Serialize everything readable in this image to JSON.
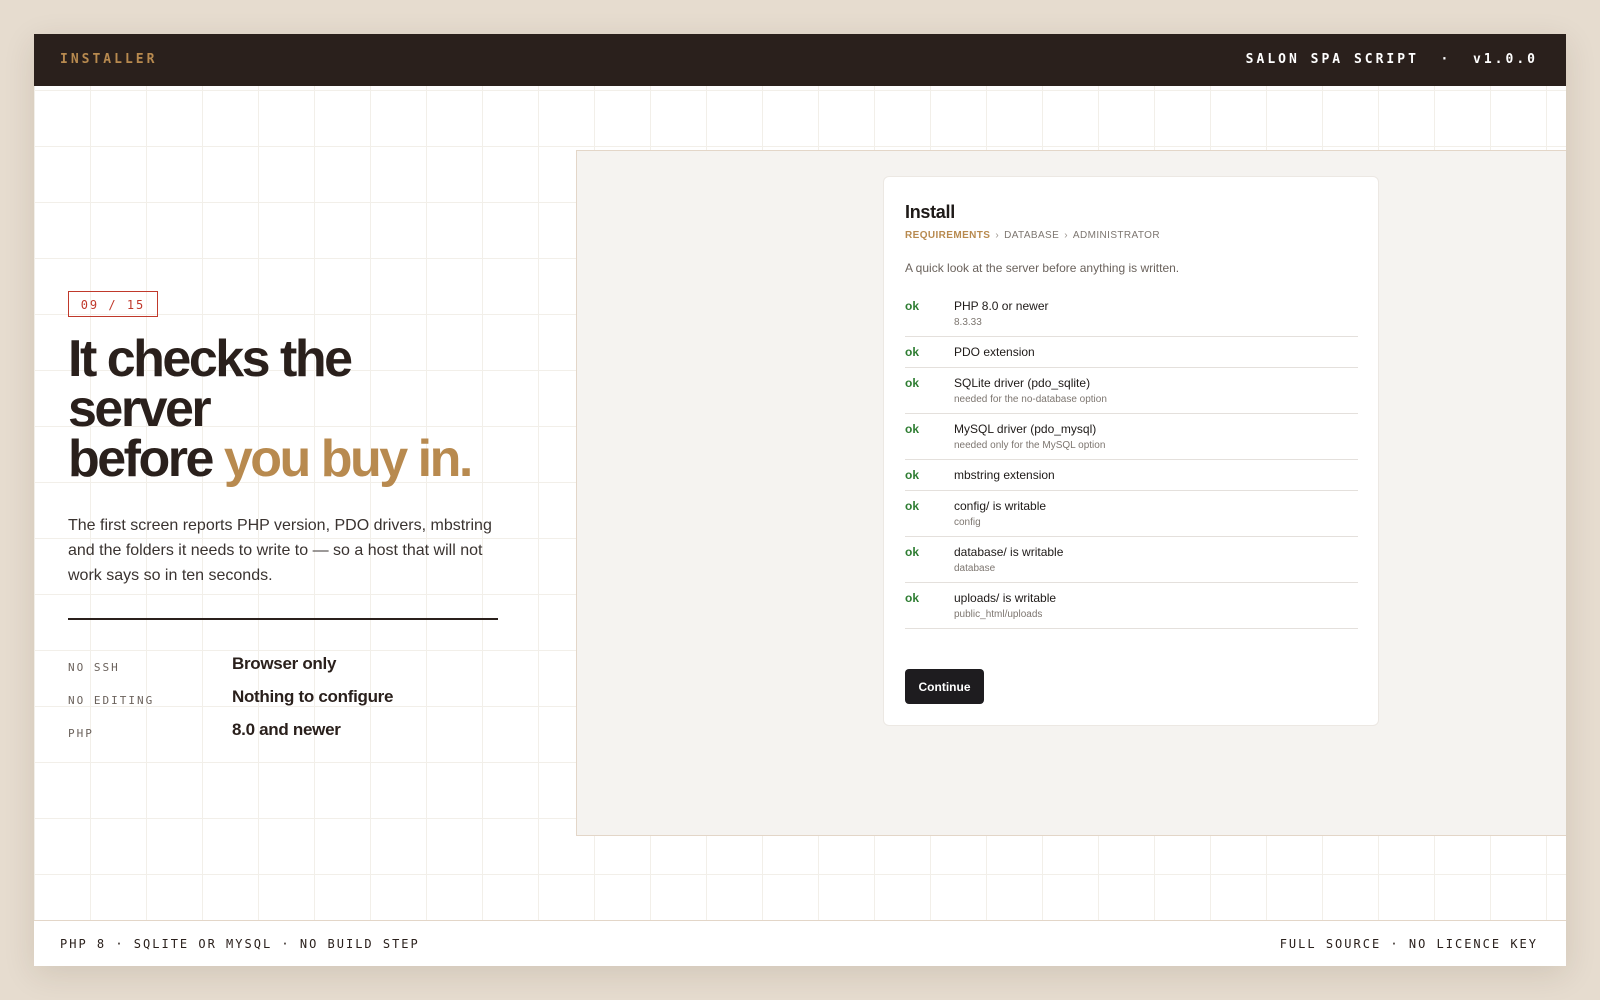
{
  "topbar": {
    "left_label": "INSTALLER",
    "right_label": "SALON SPA SCRIPT  ·  v1.0.0"
  },
  "slide": {
    "counter": "09 / 15",
    "headline_line1": "It checks the",
    "headline_line2": "server",
    "headline_line3_plain": "before ",
    "headline_line3_accent": "you buy in.",
    "lede": "The first screen reports PHP version, PDO drivers, mbstring and the folders it needs to write to — so a host that will not work says so in ten seconds."
  },
  "specs": [
    {
      "key": "NO SSH",
      "value": "Browser only"
    },
    {
      "key": "NO EDITING",
      "value": "Nothing to configure"
    },
    {
      "key": "PHP",
      "value": "8.0 and newer"
    }
  ],
  "installer": {
    "title": "Install",
    "steps": [
      "REQUIREMENTS",
      "DATABASE",
      "ADMINISTRATOR"
    ],
    "step_separator": "›",
    "intro": "A quick look at the server before anything is written.",
    "checks": [
      {
        "status": "ok",
        "label": "PHP 8.0 or newer",
        "detail": "8.3.33"
      },
      {
        "status": "ok",
        "label": "PDO extension",
        "detail": ""
      },
      {
        "status": "ok",
        "label": "SQLite driver (pdo_sqlite)",
        "detail": "needed for the no-database option"
      },
      {
        "status": "ok",
        "label": "MySQL driver (pdo_mysql)",
        "detail": "needed only for the MySQL option"
      },
      {
        "status": "ok",
        "label": "mbstring extension",
        "detail": ""
      },
      {
        "status": "ok",
        "label": "config/ is writable",
        "detail": "config"
      },
      {
        "status": "ok",
        "label": "database/ is writable",
        "detail": "database"
      },
      {
        "status": "ok",
        "label": "uploads/ is writable",
        "detail": "public_html/uploads"
      }
    ],
    "continue_label": "Continue"
  },
  "footer": {
    "left": "PHP 8 · SQLITE OR MYSQL · NO BUILD STEP",
    "right": "FULL SOURCE · NO LICENCE KEY"
  },
  "colors": {
    "dark": "#2a201c",
    "accent": "#b88a4f",
    "badge_red": "#c0392b",
    "ok_green": "#2e7d32",
    "page_bg": "#e6dccf"
  }
}
